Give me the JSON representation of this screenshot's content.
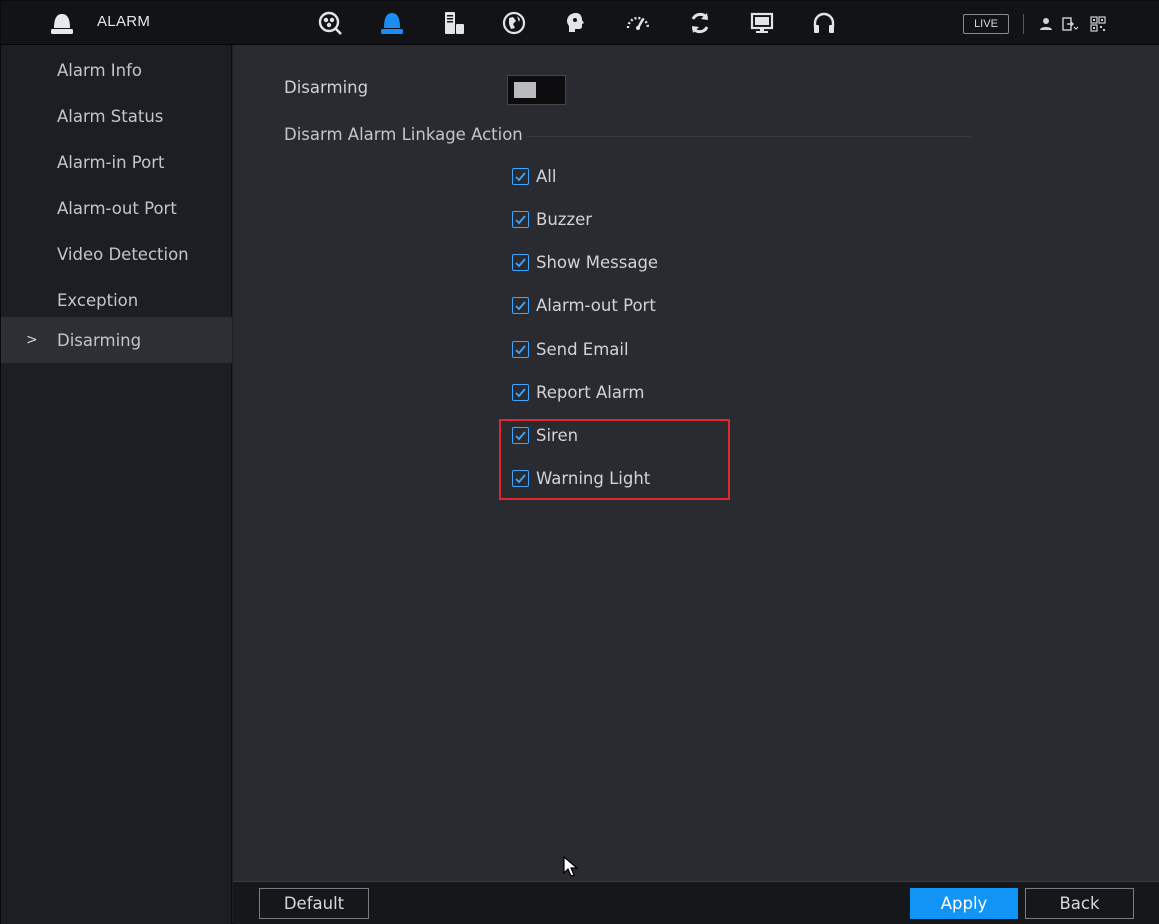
{
  "header": {
    "title": "ALARM",
    "live_label": "LIVE",
    "menu_icons": [
      "search-icon",
      "alarm-icon",
      "storage-icon",
      "network-icon",
      "ai-icon",
      "performance-icon",
      "backup-icon",
      "display-icon",
      "audio-icon"
    ]
  },
  "sidebar": {
    "items": [
      {
        "label": "Alarm Info"
      },
      {
        "label": "Alarm Status"
      },
      {
        "label": "Alarm-in Port"
      },
      {
        "label": "Alarm-out Port"
      },
      {
        "label": "Video Detection"
      },
      {
        "label": "Exception"
      },
      {
        "label": "Disarming",
        "active": true
      }
    ],
    "active_marker": ">"
  },
  "main": {
    "disarming_label": "Disarming",
    "disarming_enabled": false,
    "linkage_title": "Disarm Alarm Linkage Action",
    "options": [
      {
        "label": "All",
        "checked": true
      },
      {
        "label": "Buzzer",
        "checked": true
      },
      {
        "label": "Show Message",
        "checked": true
      },
      {
        "label": "Alarm-out Port",
        "checked": true
      },
      {
        "label": "Send Email",
        "checked": true
      },
      {
        "label": "Report Alarm",
        "checked": true
      },
      {
        "label": "Siren",
        "checked": true
      },
      {
        "label": "Warning Light",
        "checked": true
      }
    ]
  },
  "footer": {
    "default_label": "Default",
    "apply_label": "Apply",
    "back_label": "Back"
  },
  "colors": {
    "accent": "#1194f6",
    "checkbox": "#3ea6ff",
    "highlight": "#e0262e"
  }
}
